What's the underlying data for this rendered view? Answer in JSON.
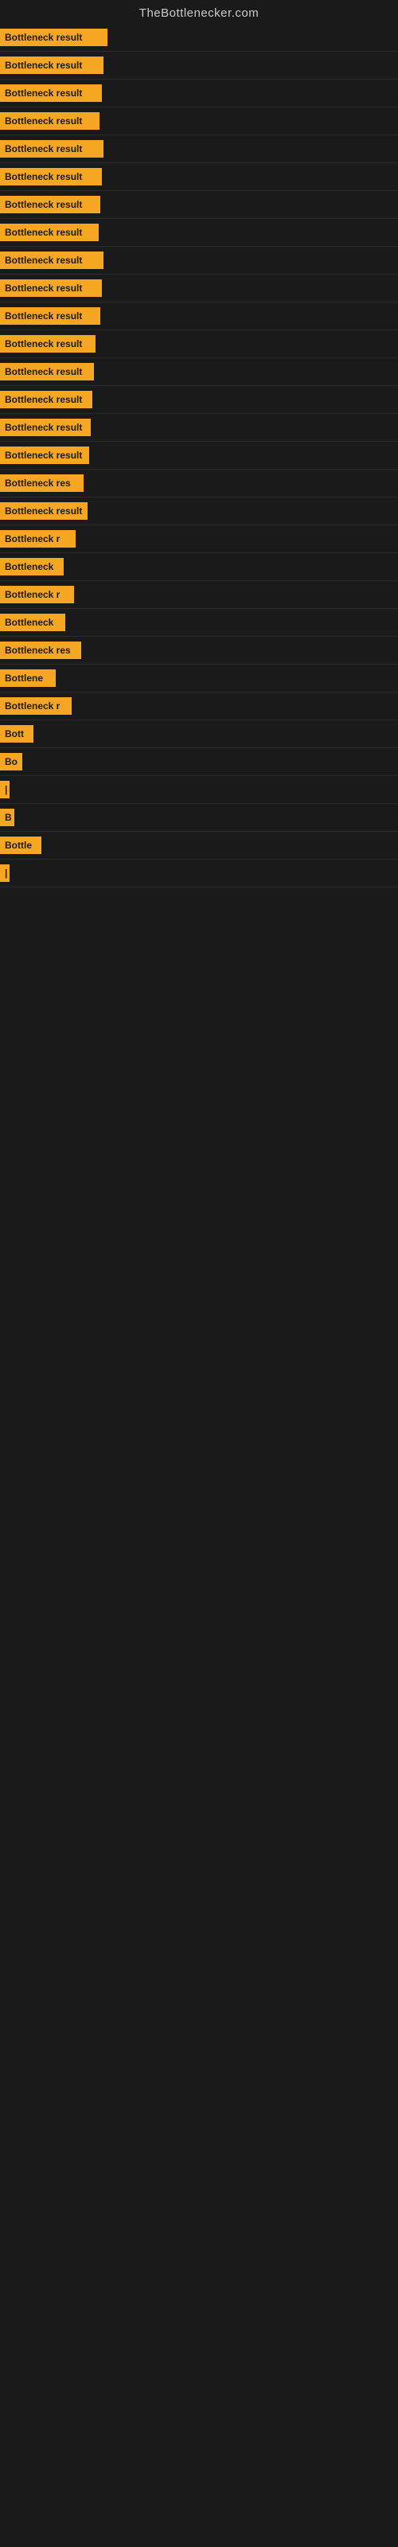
{
  "site_title": "TheBottlenecker.com",
  "bars": [
    {
      "label": "Bottleneck result",
      "width": 135
    },
    {
      "label": "Bottleneck result",
      "width": 130
    },
    {
      "label": "Bottleneck result",
      "width": 128
    },
    {
      "label": "Bottleneck result",
      "width": 125
    },
    {
      "label": "Bottleneck result",
      "width": 130
    },
    {
      "label": "Bottleneck result",
      "width": 128
    },
    {
      "label": "Bottleneck result",
      "width": 126
    },
    {
      "label": "Bottleneck result",
      "width": 124
    },
    {
      "label": "Bottleneck result",
      "width": 130
    },
    {
      "label": "Bottleneck result",
      "width": 128
    },
    {
      "label": "Bottleneck result",
      "width": 126
    },
    {
      "label": "Bottleneck result",
      "width": 120
    },
    {
      "label": "Bottleneck result",
      "width": 118
    },
    {
      "label": "Bottleneck result",
      "width": 116
    },
    {
      "label": "Bottleneck result",
      "width": 114
    },
    {
      "label": "Bottleneck result",
      "width": 112
    },
    {
      "label": "Bottleneck res",
      "width": 105
    },
    {
      "label": "Bottleneck result",
      "width": 110
    },
    {
      "label": "Bottleneck r",
      "width": 95
    },
    {
      "label": "Bottleneck",
      "width": 80
    },
    {
      "label": "Bottleneck r",
      "width": 93
    },
    {
      "label": "Bottleneck",
      "width": 82
    },
    {
      "label": "Bottleneck res",
      "width": 102
    },
    {
      "label": "Bottlene",
      "width": 70
    },
    {
      "label": "Bottleneck r",
      "width": 90
    },
    {
      "label": "Bott",
      "width": 42
    },
    {
      "label": "Bo",
      "width": 28
    },
    {
      "label": "|",
      "width": 10
    },
    {
      "label": "B",
      "width": 18
    },
    {
      "label": "Bottle",
      "width": 52
    },
    {
      "label": "|",
      "width": 8
    }
  ]
}
